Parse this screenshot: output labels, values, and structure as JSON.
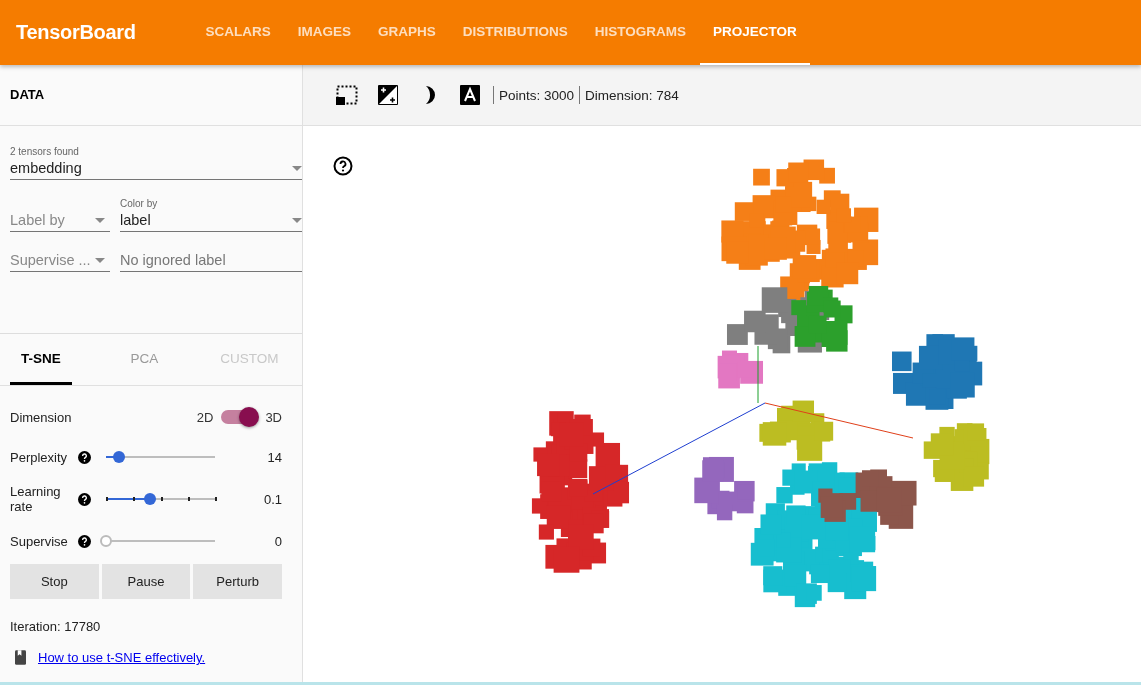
{
  "app": {
    "title": "TensorBoard"
  },
  "nav_tabs": [
    {
      "label": "SCALARS",
      "selected": false
    },
    {
      "label": "IMAGES",
      "selected": false
    },
    {
      "label": "GRAPHS",
      "selected": false
    },
    {
      "label": "DISTRIBUTIONS",
      "selected": false
    },
    {
      "label": "HISTOGRAMS",
      "selected": false
    },
    {
      "label": "PROJECTOR",
      "selected": true
    }
  ],
  "data_panel": {
    "title": "DATA",
    "tensor_select": {
      "label": "2 tensors found",
      "value": "embedding"
    },
    "label_by": {
      "placeholder": "Label by"
    },
    "color_by": {
      "label": "Color by",
      "value": "label"
    },
    "supervise_with": {
      "placeholder": "Supervise ..."
    },
    "ignored_label": {
      "placeholder": "No ignored label"
    }
  },
  "method_tabs": [
    {
      "label": "T-SNE",
      "selected": true,
      "disabled": false
    },
    {
      "label": "PCA",
      "selected": false,
      "disabled": false
    },
    {
      "label": "CUSTOM",
      "selected": false,
      "disabled": true
    }
  ],
  "tsne": {
    "dimension": {
      "label": "Dimension",
      "off_label": "2D",
      "on_label": "3D",
      "on": true
    },
    "sliders": [
      {
        "label": "Perplexity",
        "level": 0.12,
        "reading": "14",
        "ticks": false
      },
      {
        "label": "Learning rate",
        "level": 0.4,
        "reading": "0.1",
        "ticks": true
      },
      {
        "label": "Supervise",
        "level": 0,
        "reading": "0",
        "ticks": false
      }
    ],
    "buttons": [
      "Stop",
      "Pause",
      "Perturb"
    ],
    "iteration": "Iteration: 17780",
    "link": "How to use t-SNE effectively."
  },
  "toolbar": {
    "points": "Points: 3000",
    "dimension": "Dimension: 784"
  }
}
